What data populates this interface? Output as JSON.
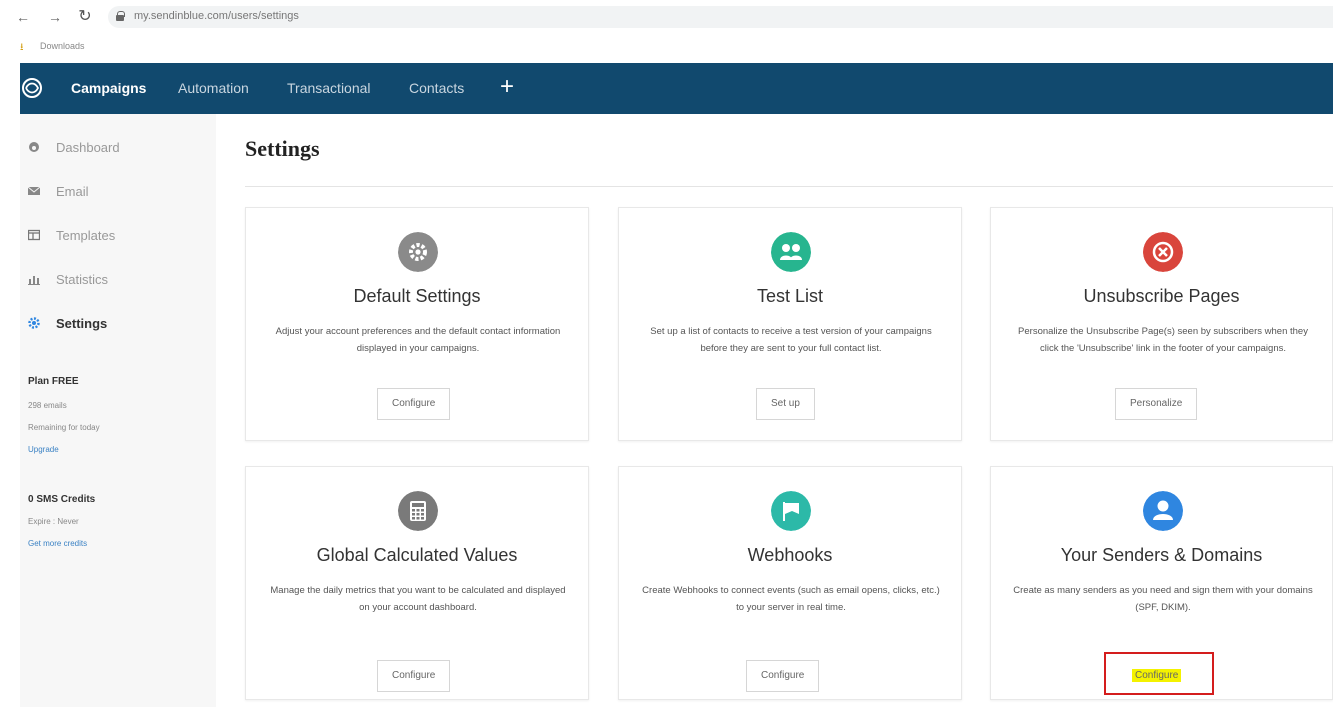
{
  "browser": {
    "url": "my.sendinblue.com/users/settings",
    "bookmark": "Downloads"
  },
  "nav": {
    "items": [
      "Campaigns",
      "Automation",
      "Transactional",
      "Contacts"
    ],
    "plus": "+"
  },
  "sidebar": {
    "items": [
      {
        "label": "Dashboard",
        "icon": "dashboard-icon"
      },
      {
        "label": "Email",
        "icon": "email-icon"
      },
      {
        "label": "Templates",
        "icon": "templates-icon"
      },
      {
        "label": "Statistics",
        "icon": "statistics-icon"
      },
      {
        "label": "Settings",
        "icon": "gear-icon"
      }
    ],
    "plan": {
      "title": "Plan FREE",
      "emails": "298 emails",
      "remaining": "Remaining for today",
      "upgrade": "Upgrade"
    },
    "sms": {
      "title": "0 SMS Credits",
      "expire": "Expire : Never",
      "link": "Get more credits"
    }
  },
  "page": {
    "title": "Settings"
  },
  "cards": [
    {
      "title": "Default Settings",
      "desc": "Adjust your account preferences and the default contact information displayed in your campaigns.",
      "button": "Configure",
      "icon": "gear-icon",
      "color": "#8a8a8a"
    },
    {
      "title": "Test List",
      "desc": "Set up a list of contacts to receive a test version of your campaigns before they are sent to your full contact list.",
      "button": "Set up",
      "icon": "users-icon",
      "color": "#27b58f"
    },
    {
      "title": "Unsubscribe Pages",
      "desc": "Personalize the Unsubscribe Page(s) seen by subscribers when they click the 'Unsubscribe' link in the footer of your campaigns.",
      "button": "Personalize",
      "icon": "close-circle-icon",
      "color": "#d9453c"
    },
    {
      "title": "Global Calculated Values",
      "desc": "Manage the daily metrics that you want to be calculated and displayed on your account dashboard.",
      "button": "Configure",
      "icon": "calculator-icon",
      "color": "#7a7a7a"
    },
    {
      "title": "Webhooks",
      "desc": "Create Webhooks to connect events (such as email opens, clicks, etc.) to your server in real time.",
      "button": "Configure",
      "icon": "flag-icon",
      "color": "#2cb9a8"
    },
    {
      "title": "Your Senders & Domains",
      "desc": "Create as many senders as you need and sign them with your domains (SPF, DKIM).",
      "button": "Configure",
      "icon": "user-icon",
      "color": "#2f86e0"
    }
  ],
  "colors": {
    "nav_bg": "#11496e",
    "highlight": "#f4f200",
    "annotation_box": "#d41d1d"
  }
}
